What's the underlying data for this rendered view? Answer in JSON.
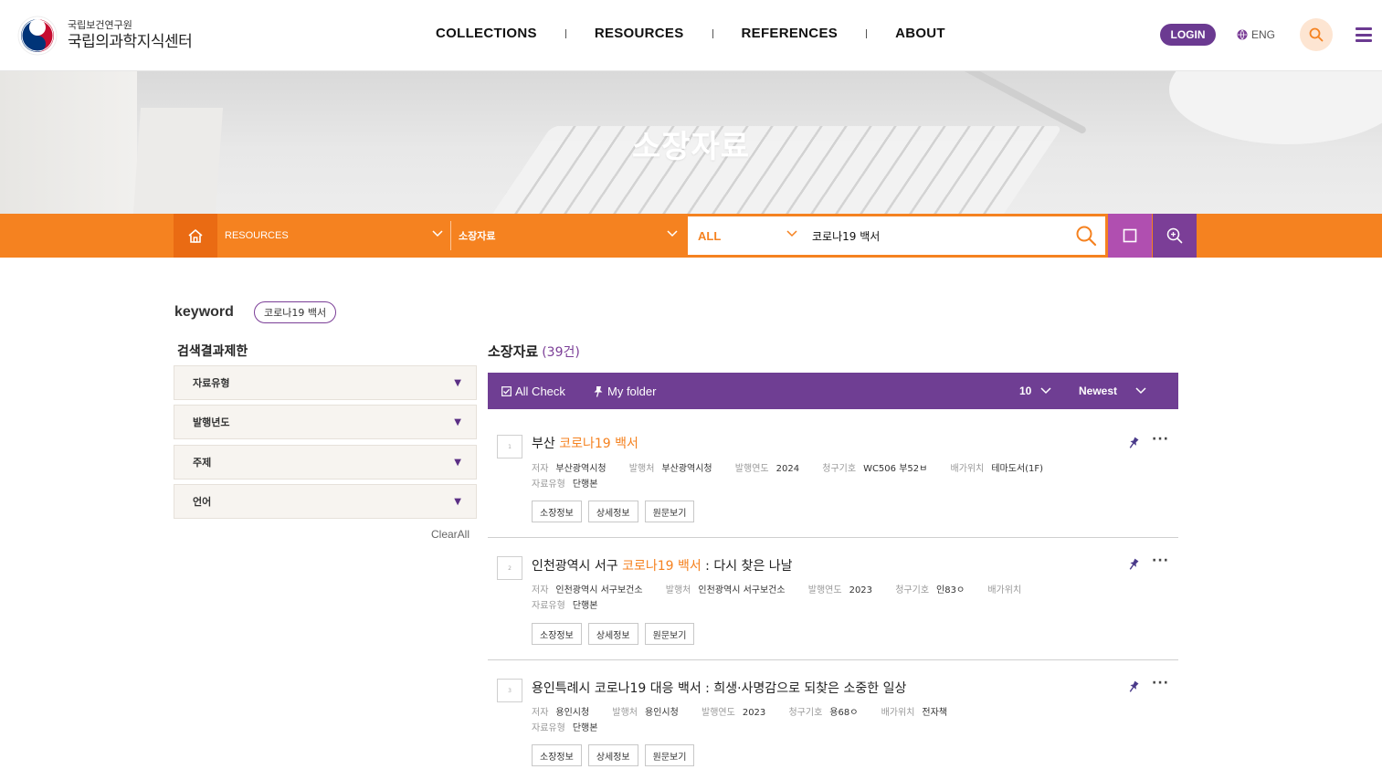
{
  "header": {
    "logo_sub": "국립보건연구원",
    "logo_main": "국립의과학지식센터",
    "nav": [
      "COLLECTIONS",
      "RESOURCES",
      "REFERENCES",
      "ABOUT"
    ],
    "login_label": "LOGIN",
    "lang_label": "ENG",
    "icons": [
      "globe-icon",
      "search-icon",
      "hamburger-menu-icon"
    ]
  },
  "hero": {
    "title": "소장자료"
  },
  "searchbar": {
    "category_1": "RESOURCES",
    "category_2": "소장자료",
    "scope": "ALL",
    "query": "코로나19 백서",
    "accent_color": "#f58220"
  },
  "keyword": {
    "label": "keyword",
    "chip": "코로나19 백서"
  },
  "filters": {
    "title": "검색결과제한",
    "facets": [
      "자료유형",
      "발행년도",
      "주제",
      "언어"
    ],
    "clear_all": "ClearAll"
  },
  "results": {
    "title": "소장자료",
    "count": "(39건)",
    "toolbar": {
      "all_check": "All Check",
      "my_folder": "My folder",
      "page_size": "10",
      "sort": "Newest",
      "color": "#6f3e93"
    },
    "items": [
      {
        "num": "1",
        "title_pre": "부산 ",
        "title_hl": "코로나19 백서",
        "title_post": "",
        "meta1": [
          {
            "k": "저자",
            "v": "부산광역시청"
          },
          {
            "k": "발행처",
            "v": "부산광역시청"
          },
          {
            "k": "발행연도",
            "v": "2024"
          },
          {
            "k": "청구기호",
            "v": "WC506 부52ㅂ"
          },
          {
            "k": "배가위치",
            "v": "테마도서(1F)"
          }
        ],
        "meta2": [
          {
            "k": "자료유형",
            "v": "단행본"
          }
        ],
        "buttons": [
          "소장정보",
          "상세정보",
          "원문보기"
        ]
      },
      {
        "num": "2",
        "title_pre": "인천광역시 서구 ",
        "title_hl": "코로나19 백서",
        "title_post": " : 다시 찾은 나날",
        "meta1": [
          {
            "k": "저자",
            "v": "인천광역시 서구보건소"
          },
          {
            "k": "발행처",
            "v": "인천광역시 서구보건소"
          },
          {
            "k": "발행연도",
            "v": "2023"
          },
          {
            "k": "청구기호",
            "v": "인83ㅇ"
          },
          {
            "k": "배가위치",
            "v": ""
          }
        ],
        "meta2": [
          {
            "k": "자료유형",
            "v": "단행본"
          }
        ],
        "buttons": [
          "소장정보",
          "상세정보",
          "원문보기"
        ]
      },
      {
        "num": "3",
        "title_pre": "용인특례시 코로나19 대응 백서 : 희생·사명감으로 되찾은 소중한 일상",
        "title_hl": "",
        "title_post": "",
        "meta1": [
          {
            "k": "저자",
            "v": "용인시청"
          },
          {
            "k": "발행처",
            "v": "용인시청"
          },
          {
            "k": "발행연도",
            "v": "2023"
          },
          {
            "k": "청구기호",
            "v": "용68ㅇ"
          },
          {
            "k": "배가위치",
            "v": "전자책"
          }
        ],
        "meta2": [
          {
            "k": "자료유형",
            "v": "단행본"
          }
        ],
        "buttons": [
          "소장정보",
          "상세정보",
          "원문보기"
        ]
      }
    ]
  }
}
